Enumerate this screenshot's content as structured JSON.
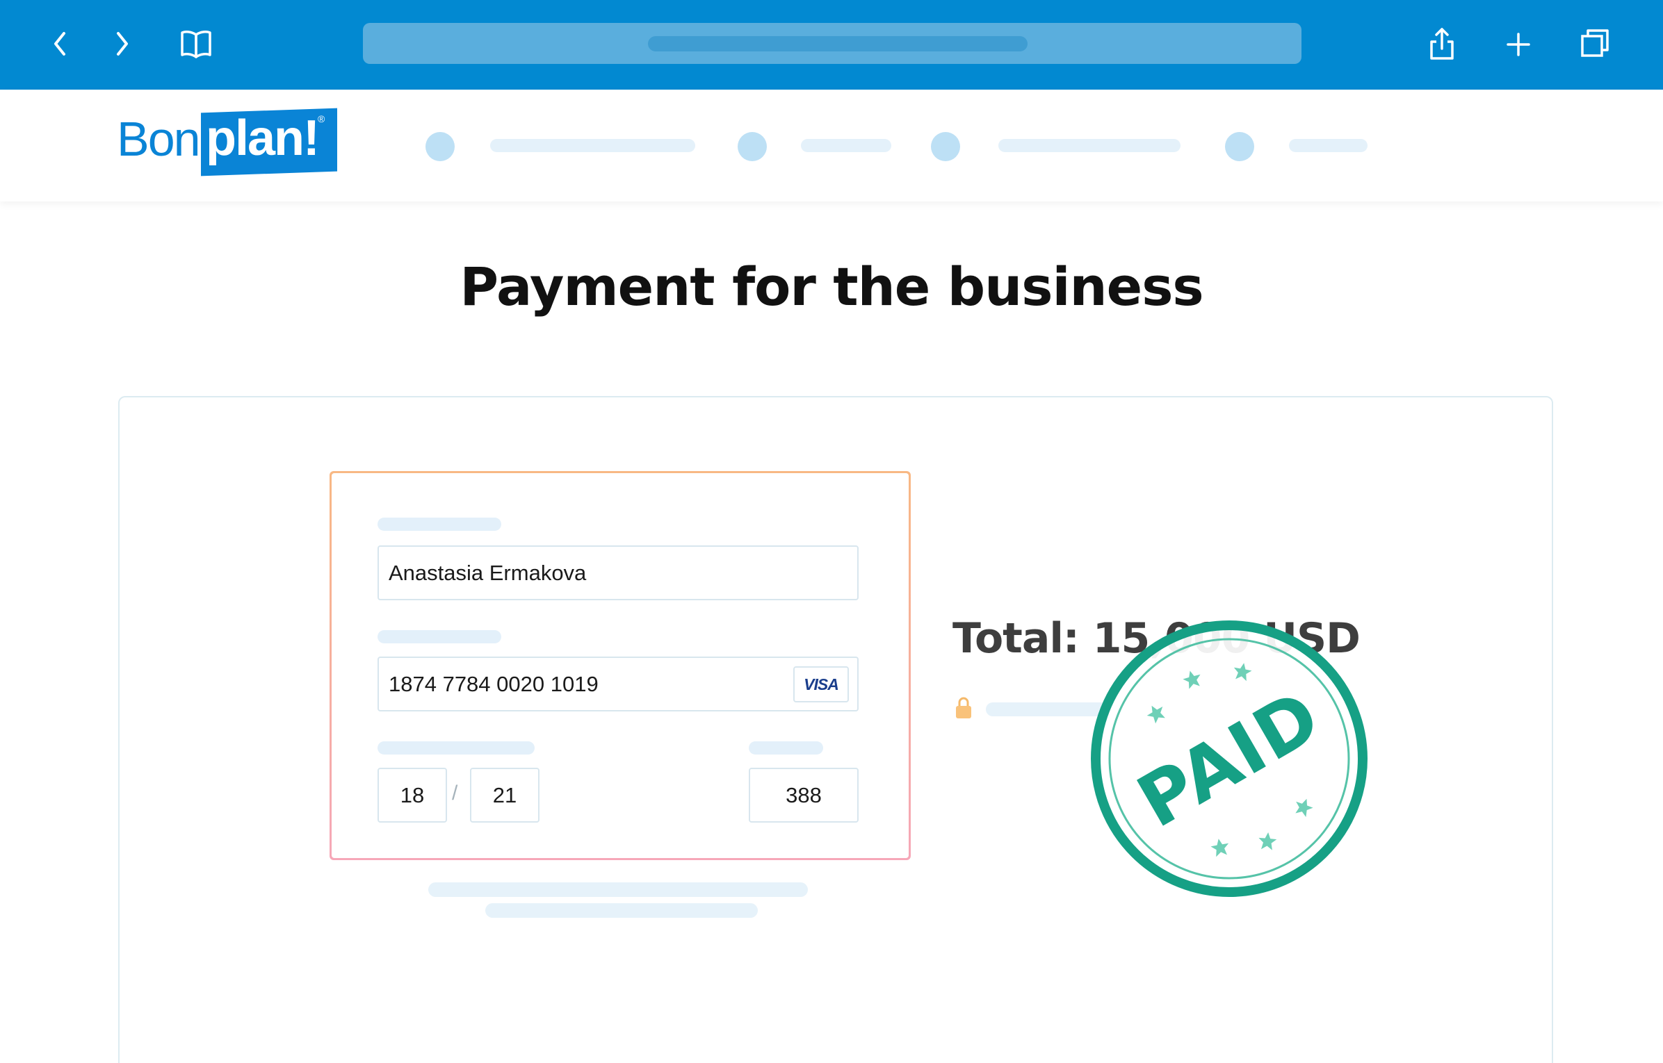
{
  "browser": {
    "icons": [
      "chevron-left-icon",
      "chevron-right-icon",
      "book-icon",
      "share-icon",
      "plus-icon",
      "tabs-icon"
    ],
    "toolbar_color": "#0289d1"
  },
  "header": {
    "logo": {
      "word1": "Bon",
      "word2": "plan!",
      "mark": "®"
    },
    "brand_color": "#0a84d6"
  },
  "page": {
    "title": "Payment for the business"
  },
  "payment_form": {
    "name_value": "Anastasia Ermakova",
    "card_number_value": "1874 7784 0020 1019",
    "card_brand": "VISA",
    "expiry_month": "18",
    "expiry_separator": "/",
    "expiry_year": "21",
    "cvv_value": "388"
  },
  "summary": {
    "total_text": "Total: 15,000 USD"
  },
  "stamp": {
    "text": "PAID",
    "color": "#16a085"
  }
}
